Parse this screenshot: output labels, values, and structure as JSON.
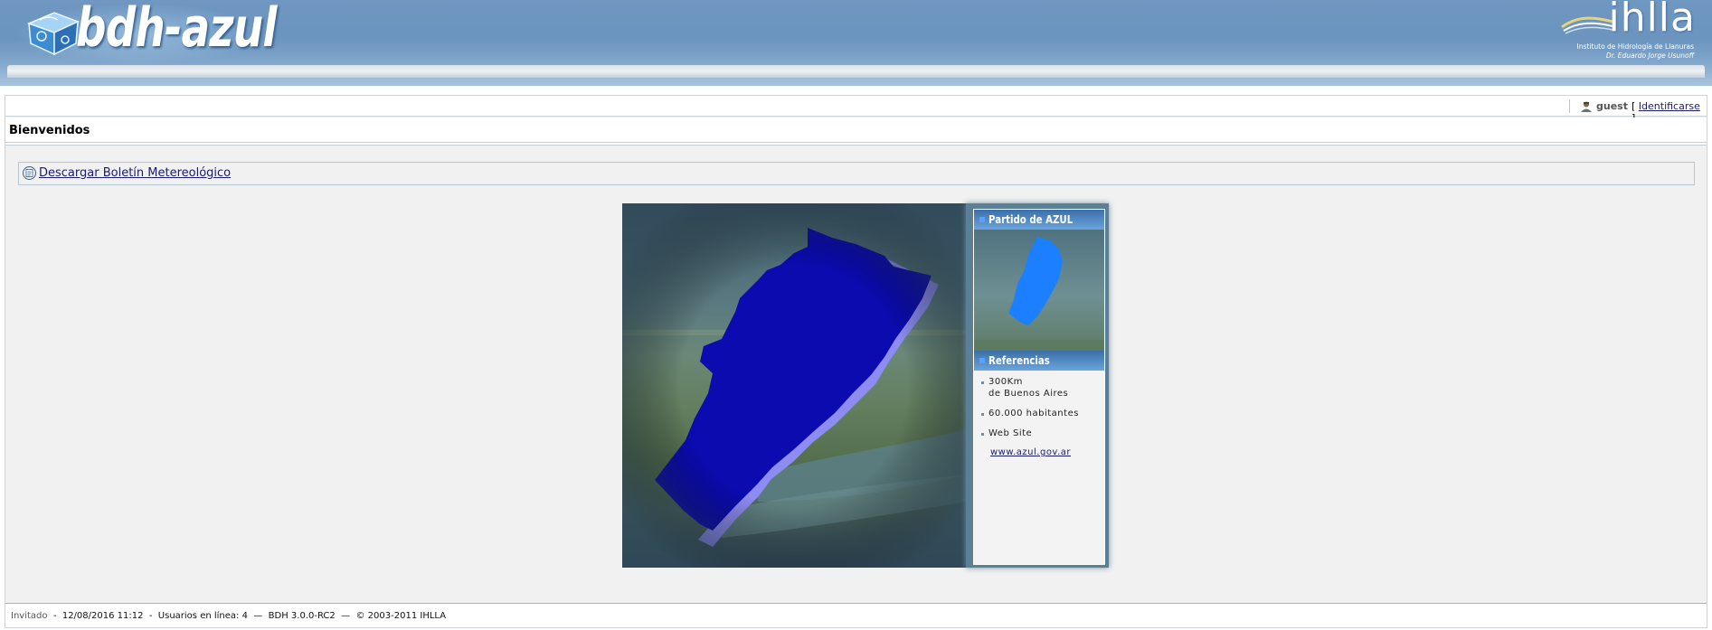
{
  "header": {
    "logo_text": "bdh-azul",
    "org_logo": "ihlla",
    "org_line1": "Instituto de Hidrología de Llanuras",
    "org_line2": "Dr. Eduardo Jorge Usunoff"
  },
  "userbar": {
    "user_icon": "user-icon",
    "username": "guest",
    "login_open": "[ ",
    "login_label": "Identificarse",
    "login_close": " ]"
  },
  "page": {
    "title": "Bienvenidos"
  },
  "download": {
    "icon": "document-icon",
    "label": "Descargar Boletín Metereológico"
  },
  "side_panel": {
    "heading1": "Partido de AZUL",
    "heading2": "Referencias",
    "references": [
      {
        "line1": "300Km",
        "line2": "de Buenos Aires"
      },
      {
        "line1": "60.000 habitantes",
        "line2": ""
      },
      {
        "line1": "Web Site",
        "line2": ""
      }
    ],
    "website": "www.azul.gov.ar"
  },
  "colors": {
    "header_blue": "#6f97c0",
    "map_fill": "#0b0bb0",
    "map_edge": "#8f8ff5",
    "thumb_fill": "#1b7fff",
    "link": "#1a1a6e"
  },
  "footer": {
    "role": "Invitado",
    "sep1": "  -  ",
    "datetime": "12/08/2016 11:12",
    "sep2": "  -  ",
    "online": "Usuarios en línea: 4",
    "sep3": "  —  ",
    "version": "BDH 3.0.0-RC2",
    "sep4": "  —  ",
    "copyright": "© 2003-2011 IHLLA"
  }
}
